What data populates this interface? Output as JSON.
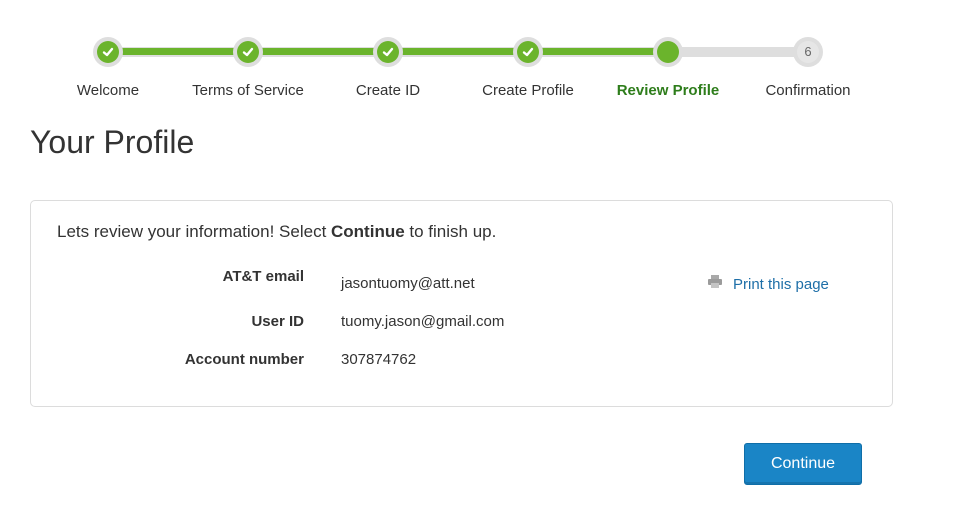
{
  "progress": {
    "steps": [
      {
        "label": "Welcome",
        "status": "complete"
      },
      {
        "label": "Terms of Service",
        "status": "complete"
      },
      {
        "label": "Create ID",
        "status": "complete"
      },
      {
        "label": "Create Profile",
        "status": "complete"
      },
      {
        "label": "Review Profile",
        "status": "current"
      },
      {
        "label": "Confirmation",
        "status": "pending",
        "number": "6"
      }
    ]
  },
  "page": {
    "title": "Your Profile"
  },
  "review": {
    "intro_prefix": "Lets review your information! Select ",
    "intro_bold": "Continue",
    "intro_suffix": " to finish up.",
    "fields": [
      {
        "label": "AT&T email",
        "value": "jasontuomy@att.net"
      },
      {
        "label": "User ID",
        "value": "tuomy.jason@gmail.com"
      },
      {
        "label": "Account number",
        "value": "307874762"
      }
    ],
    "print_label": "Print this page"
  },
  "actions": {
    "continue_label": "Continue"
  },
  "colors": {
    "progress_green": "#6bb42c",
    "active_label": "#2e7d1b",
    "link_blue": "#1e6fa8",
    "button_blue": "#1a85c6"
  }
}
